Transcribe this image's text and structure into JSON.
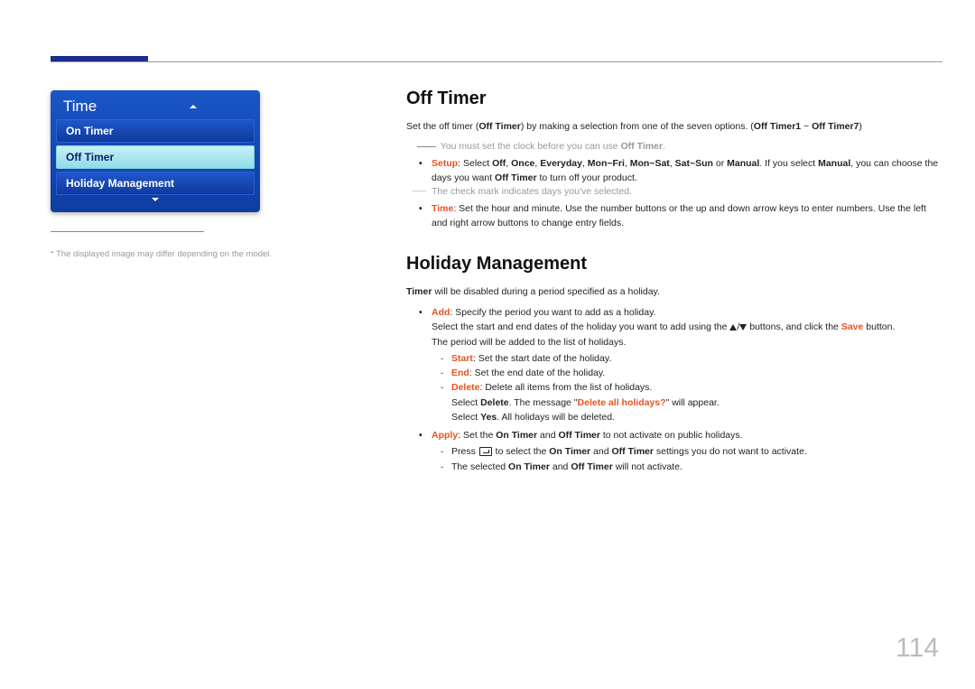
{
  "page_number": "114",
  "menu": {
    "title": "Time",
    "items": [
      {
        "label": "On Timer",
        "active": false
      },
      {
        "label": "Off Timer",
        "active": true
      },
      {
        "label": "Holiday Management",
        "active": false
      }
    ]
  },
  "side_note": "The displayed image may differ depending on the model.",
  "off_timer": {
    "heading": "Off Timer",
    "intro_pre": "Set the off timer (",
    "intro_bold1": "Off Timer",
    "intro_mid": ") by making a selection from one of the seven options. (",
    "intro_bold2": "Off Timer1",
    "intro_tilde": " ~ ",
    "intro_bold3": "Off Timer7",
    "intro_post": ")",
    "note_pre": "You must set the clock before you can use ",
    "note_bold": "Off Timer",
    "note_post": ".",
    "setup": {
      "label": "Setup",
      "text1": ": Select ",
      "opt_off": "Off",
      "c1": ", ",
      "opt_once": "Once",
      "c2": ", ",
      "opt_everyday": "Everyday",
      "c3": ", ",
      "opt_monfri": "Mon~Fri",
      "c4": ", ",
      "opt_monsat": "Mon~Sat",
      "c5": ", ",
      "opt_satsun": "Sat~Sun",
      "c6": " or ",
      "opt_manual": "Manual",
      "text2": ". If you select ",
      "manual2": "Manual",
      "text3": ", you can choose the days you want ",
      "offtimer": "Off Timer",
      "text4": " to turn off your product."
    },
    "checkmark_note": "The check mark indicates days you've selected.",
    "time": {
      "label": "Time",
      "text": ": Set the hour and minute. Use the number buttons or the up and down arrow keys to enter numbers. Use the left and right arrow buttons to change entry fields."
    }
  },
  "holiday": {
    "heading": "Holiday Management",
    "intro_bold": "Timer",
    "intro_rest": " will be disabled during a period specified as a holiday.",
    "add": {
      "label": "Add",
      "text": ": Specify the period you want to add as a holiday.",
      "select_text1": "Select the start and end dates of the holiday you want to add using the ",
      "select_text2": " buttons, and click the ",
      "save": "Save",
      "select_text3": " button.",
      "period_text": "The period will be added to the list of holidays."
    },
    "start": {
      "label": "Start",
      "text": ": Set the start date of the holiday."
    },
    "end": {
      "label": "End",
      "text": ": Set the end date of the holiday."
    },
    "delete": {
      "label": "Delete",
      "text": ": Delete all items from the list of holidays.",
      "line2a": "Select ",
      "line2b": "Delete",
      "line2c": ". The message \"",
      "line2d": "Delete all holidays?",
      "line2e": "\" will appear.",
      "line3a": "Select ",
      "line3b": "Yes",
      "line3c": ". All holidays will be deleted."
    },
    "apply": {
      "label": "Apply",
      "text1": ": Set the ",
      "on": "On Timer",
      "and1": " and ",
      "off": "Off Timer",
      "text2": " to not activate on public holidays.",
      "sub1a": "Press ",
      "sub1b": " to select the ",
      "sub1_on": "On Timer",
      "sub1c": " and ",
      "sub1_off": "Off Timer",
      "sub1d": " settings you do not want to activate.",
      "sub2a": "The selected ",
      "sub2_on": "On Timer",
      "sub2b": " and ",
      "sub2_off": "Off Timer",
      "sub2c": " will not activate."
    }
  }
}
